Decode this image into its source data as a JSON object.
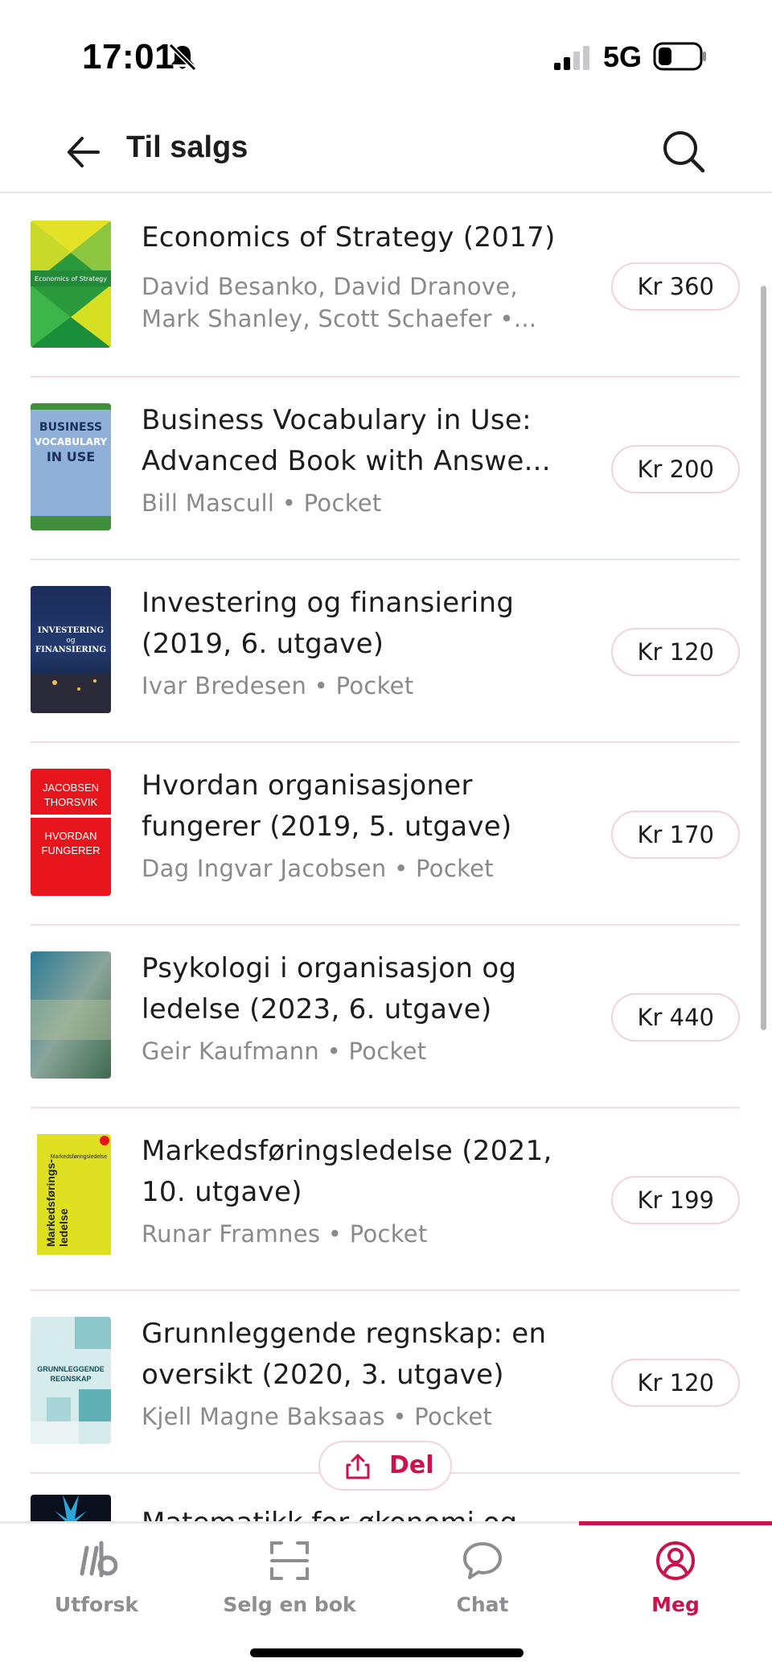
{
  "status_bar": {
    "time": "17:01",
    "network": "5G"
  },
  "header": {
    "title": "Til salgs"
  },
  "books": [
    {
      "title": "Economics of Strategy (2017)",
      "meta": "David Besanko, David Dranove, Mark Shanley, Scott Schaefer •...",
      "price": "Kr 360",
      "cover_text": "Economics of Strategy"
    },
    {
      "title": "Business Vocabulary in Use: Advanced Book with Answe...",
      "meta": "Bill Mascull • Pocket",
      "price": "Kr 200",
      "cover_text": "BUSINESS VOCABULARY IN USE"
    },
    {
      "title": "Investering og finansiering (2019, 6. utgave)",
      "meta": "Ivar Bredesen • Pocket",
      "price": "Kr 120",
      "cover_text": "INVESTERING og FINANSIERING"
    },
    {
      "title": "Hvordan organisasjoner fungerer (2019, 5. utgave)",
      "meta": "Dag Ingvar Jacobsen • Pocket",
      "price": "Kr 170",
      "cover_text": "JACOBSEN THORSVIK HVORDAN FUNGERER"
    },
    {
      "title": "Psykologi i organisasjon og ledelse (2023, 6. utgave)",
      "meta": "Geir Kaufmann • Pocket",
      "price": "Kr 440",
      "cover_text": ""
    },
    {
      "title": "Markedsføringsledelse (2021, 10. utgave)",
      "meta": "Runar Framnes • Pocket",
      "price": "Kr 199",
      "cover_text": "Markedsførings-ledelse"
    },
    {
      "title": "Grunnleggende regnskap: en oversikt (2020, 3. utgave)",
      "meta": "Kjell Magne Baksaas • Pocket",
      "price": "Kr 120",
      "cover_text": "GRUNNLEGGENDE REGNSKAP"
    },
    {
      "title": "Matematikk for økonomi og"
    }
  ],
  "share": {
    "label": "Del"
  },
  "tabs": [
    {
      "label": "Utforsk",
      "icon": "brand-logo-icon"
    },
    {
      "label": "Selg en bok",
      "icon": "scan-icon"
    },
    {
      "label": "Chat",
      "icon": "chat-bubble-icon"
    },
    {
      "label": "Meg",
      "icon": "profile-icon",
      "active": true
    }
  ],
  "colors": {
    "accent": "#c8144b",
    "muted": "#8d8d92",
    "divider": "#f3dde2"
  }
}
